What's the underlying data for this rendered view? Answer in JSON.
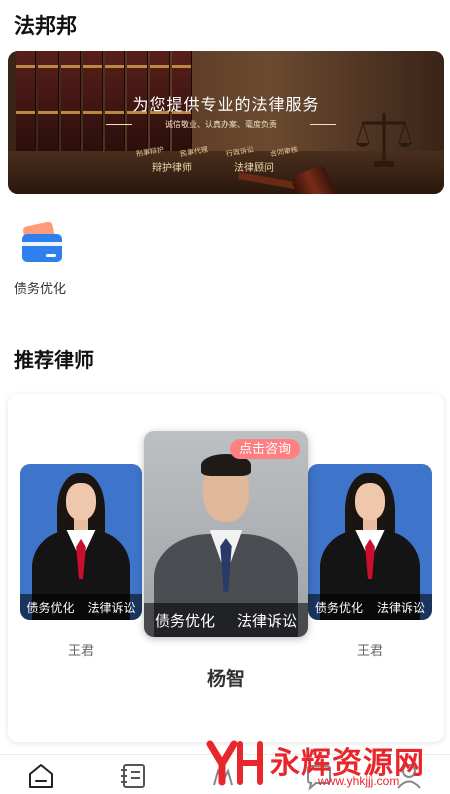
{
  "app": {
    "title": "法邦邦"
  },
  "banner": {
    "headline": "为您提供专业的法律服务",
    "subline": "诚信敬业、认真办案、毫度负责",
    "tags": [
      "刑事辩护",
      "民事代理",
      "行政诉讼",
      "合同审核"
    ],
    "roles": [
      "辩护律师",
      "法律顾问"
    ]
  },
  "services": [
    {
      "label": "债务优化",
      "icon": "credit-card-icon"
    }
  ],
  "recommend": {
    "title": "推荐律师",
    "consult_badge": "点击咨询",
    "lawyers": [
      {
        "name": "王君",
        "tags": [
          "债务优化",
          "法律诉讼"
        ]
      },
      {
        "name": "杨智",
        "tags": [
          "债务优化",
          "法律诉讼"
        ]
      },
      {
        "name": "王君",
        "tags": [
          "债务优化",
          "法律诉讼"
        ]
      }
    ]
  },
  "tabbar": {
    "tabs": [
      {
        "icon": "home-icon"
      },
      {
        "icon": "list-icon"
      },
      {
        "icon": "consult-icon"
      },
      {
        "icon": "message-icon"
      },
      {
        "icon": "profile-icon"
      }
    ]
  },
  "watermark": {
    "text": "永辉资源网",
    "url": "www.yhkjjj.com"
  },
  "colors": {
    "badge": "#ff7f82",
    "card_blue": "#2f80ed",
    "watermark": "#e8272c",
    "lawyer_bg": "#3e74c9"
  }
}
